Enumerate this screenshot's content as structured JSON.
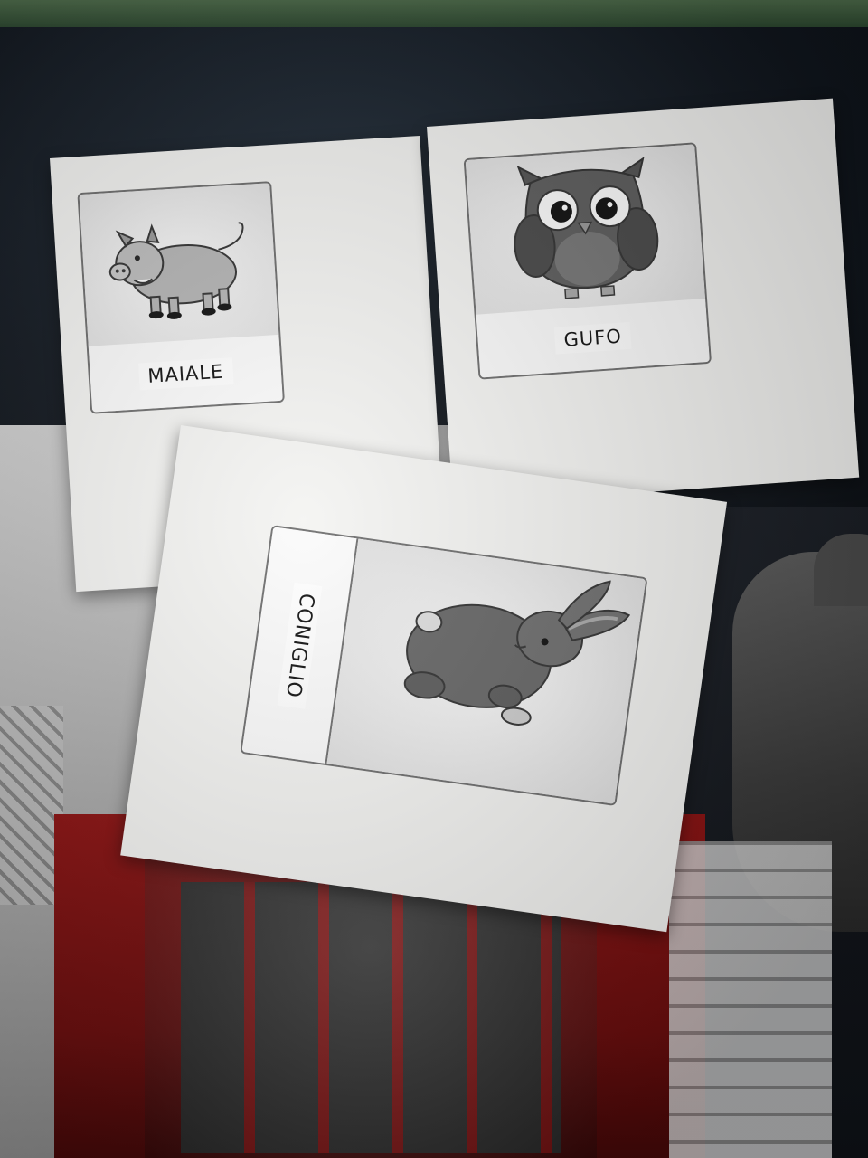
{
  "cards": {
    "maiale": {
      "label": "MAIALE",
      "animal": "pig"
    },
    "gufo": {
      "label": "GUFO",
      "animal": "owl"
    },
    "coniglio": {
      "label": "CONIGLIO",
      "animal": "rabbit"
    }
  },
  "colors": {
    "paper": "#f4f4f2",
    "frame": "#6e6e6e",
    "red_booth": "#8a1010",
    "dark_fabric": "#121820"
  }
}
